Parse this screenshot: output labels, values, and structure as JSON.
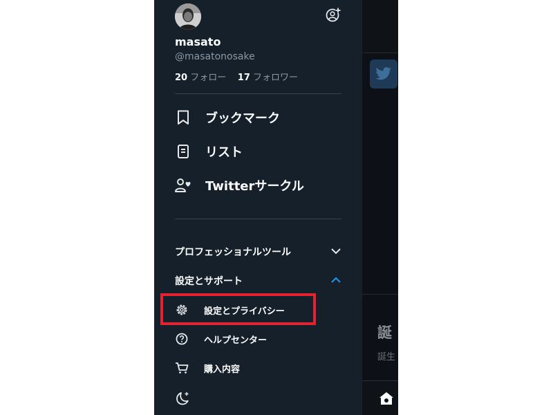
{
  "profile": {
    "display_name": "masato",
    "handle": "@masatonosake",
    "following_count": "20",
    "following_label": "フォロー",
    "followers_count": "17",
    "followers_label": "フォロワー"
  },
  "menu": [
    {
      "label": "ブックマーク",
      "icon": "bookmark-icon"
    },
    {
      "label": "リスト",
      "icon": "list-icon"
    },
    {
      "label": "Twitterサークル",
      "icon": "twitter-circle-icon"
    }
  ],
  "sections": {
    "professional_tools": {
      "label": "プロフェッショナルツール",
      "expanded": false
    },
    "settings_support": {
      "label": "設定とサポート",
      "expanded": true
    }
  },
  "settings_items": [
    {
      "label": "設定とプライバシー",
      "icon": "gear-icon",
      "highlighted": true
    },
    {
      "label": "ヘルプセンター",
      "icon": "help-icon"
    },
    {
      "label": "購入内容",
      "icon": "cart-icon"
    }
  ],
  "background": {
    "heading_fragment": "誕",
    "sub_fragment": "誕生"
  },
  "colors": {
    "drawer_bg": "#15202b",
    "accent_blue": "#1d9bf0",
    "highlight_red": "#e3232f"
  }
}
